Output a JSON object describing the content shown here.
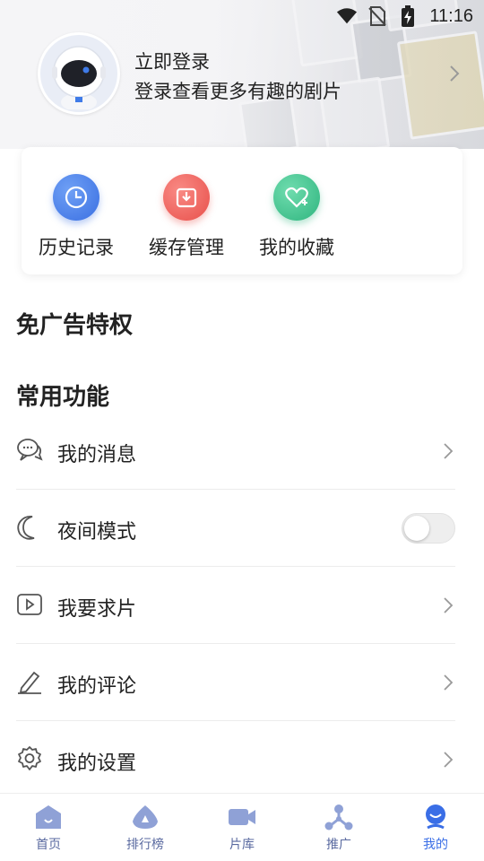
{
  "status_bar": {
    "time": "11:16"
  },
  "profile": {
    "title": "立即登录",
    "subtitle": "登录查看更多有趣的剧片"
  },
  "quick_actions": [
    {
      "label": "历史记录",
      "icon": "history-clock-icon",
      "color": "#3f78e8"
    },
    {
      "label": "缓存管理",
      "icon": "download-tray-icon",
      "color": "#ee5a55"
    },
    {
      "label": "我的收藏",
      "icon": "heart-icon",
      "color": "#37c48e"
    }
  ],
  "ad_free": {
    "title": "免广告特权"
  },
  "common": {
    "title": "常用功能",
    "items": [
      {
        "label": "我的消息",
        "icon": "message-bubbles-icon",
        "control": "chevron"
      },
      {
        "label": "夜间模式",
        "icon": "moon-icon",
        "control": "toggle",
        "toggle_on": false
      },
      {
        "label": "我要求片",
        "icon": "play-box-icon",
        "control": "chevron"
      },
      {
        "label": "我的评论",
        "icon": "pen-icon",
        "control": "chevron"
      },
      {
        "label": "我的设置",
        "icon": "gear-icon",
        "control": "chevron"
      }
    ]
  },
  "bottom_nav": {
    "items": [
      {
        "label": "首页",
        "icon": "home-icon",
        "active": false
      },
      {
        "label": "排行榜",
        "icon": "ranking-icon",
        "active": false
      },
      {
        "label": "片库",
        "icon": "video-camera-icon",
        "active": false
      },
      {
        "label": "推广",
        "icon": "share-nodes-icon",
        "active": false
      },
      {
        "label": "我的",
        "icon": "profile-icon",
        "active": true
      }
    ],
    "colors": {
      "inactive": "#8fa1d6",
      "active": "#3a6ee6"
    }
  }
}
